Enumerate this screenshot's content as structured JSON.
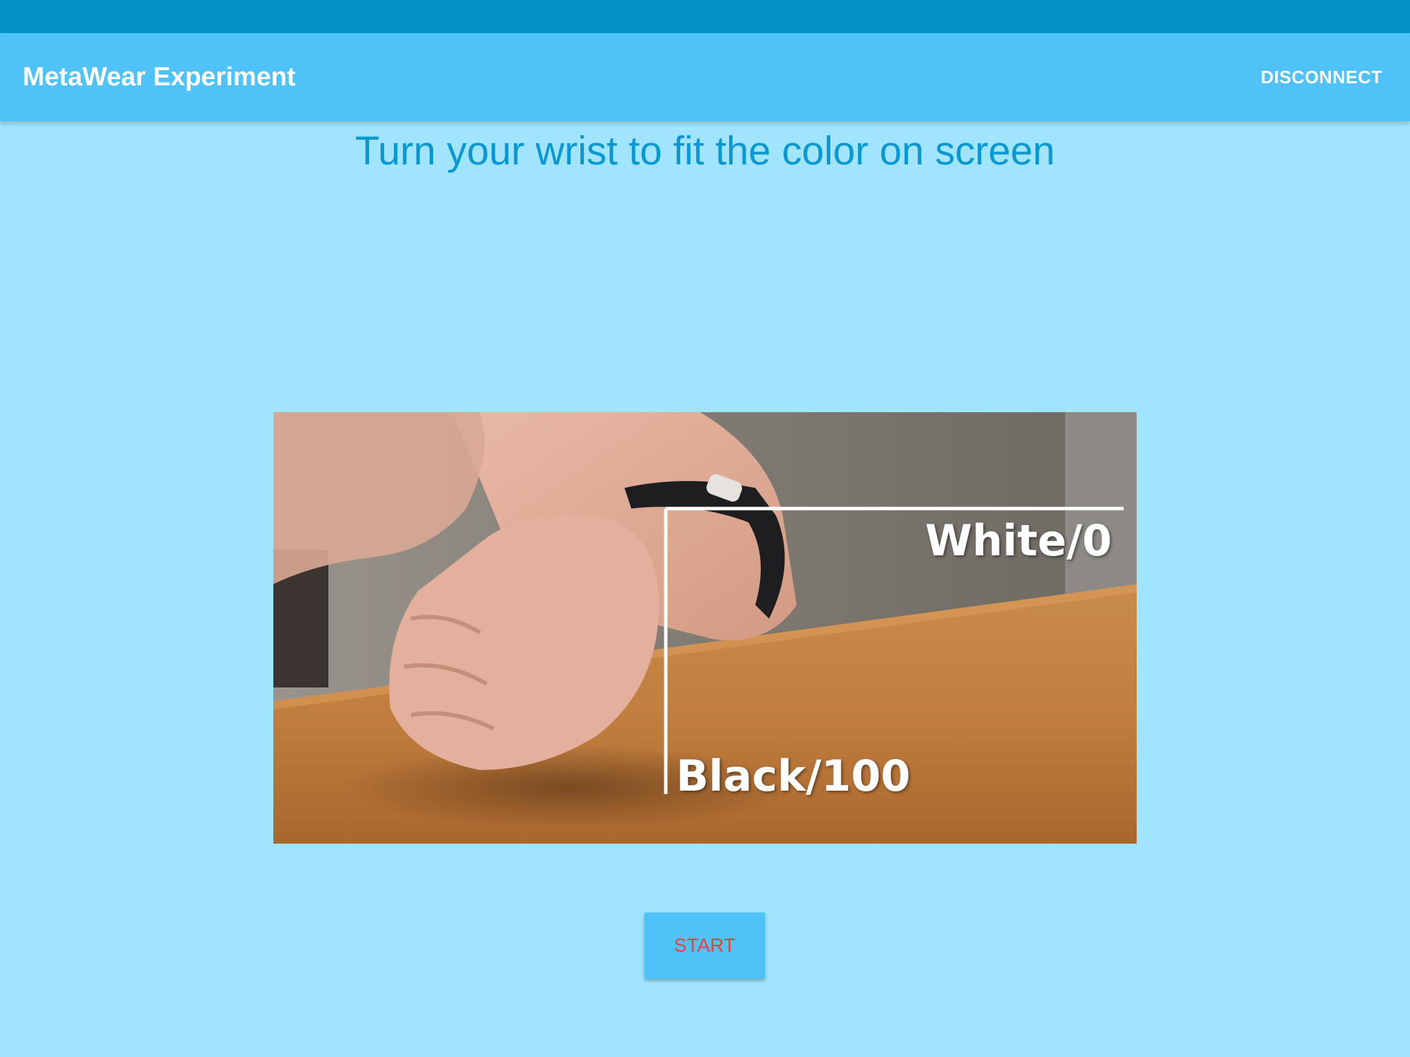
{
  "status_bar": {
    "color": "#0293c8"
  },
  "app_bar": {
    "title": "MetaWear Experiment",
    "disconnect_label": "DISCONNECT",
    "color": "#4fc3f7"
  },
  "main": {
    "instruction": "Turn your wrist to fit the color on screen",
    "demo_image": {
      "label_top": "White/0",
      "label_bottom": "Black/100"
    },
    "start_label": "START",
    "background_color": "#a1e4fe",
    "start_text_color": "#f23b3b"
  }
}
